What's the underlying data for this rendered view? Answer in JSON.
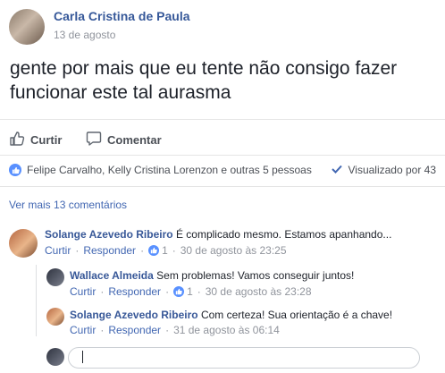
{
  "post": {
    "author": "Carla Cristina de Paula",
    "date": "13 de agosto",
    "text": "gente por mais que eu tente não consigo fazer funcionar este tal aurasma"
  },
  "actions": {
    "like": "Curtir",
    "comment": "Comentar"
  },
  "reactions": {
    "likers": "Felipe Carvalho, Kelly Cristina Lorenzon e outras 5 pessoas",
    "seen": "Visualizado por 43"
  },
  "more_comments": "Ver mais 13 comentários",
  "comments": [
    {
      "name": "Solange Azevedo Ribeiro",
      "text": "É complicado mesmo. Estamos apanhando...",
      "like": "Curtir",
      "reply": "Responder",
      "likes": "1",
      "time": "30 de agosto às 23:25"
    }
  ],
  "replies": [
    {
      "name": "Wallace Almeida",
      "text": "Sem problemas! Vamos conseguir juntos!",
      "like": "Curtir",
      "reply": "Responder",
      "likes": "1",
      "time": "30 de agosto às 23:28"
    },
    {
      "name": "Solange Azevedo Ribeiro",
      "text": "Com certeza! Sua orientação é a chave!",
      "like": "Curtir",
      "reply": "Responder",
      "time": "31 de agosto às 06:14"
    }
  ],
  "colors": {
    "link": "#385898",
    "accent": "#4267b2",
    "like_badge": "#5890ff"
  },
  "icons": [
    "thumbs-up-icon",
    "comment-bubble-icon",
    "like-badge-icon",
    "checkmark-icon"
  ]
}
